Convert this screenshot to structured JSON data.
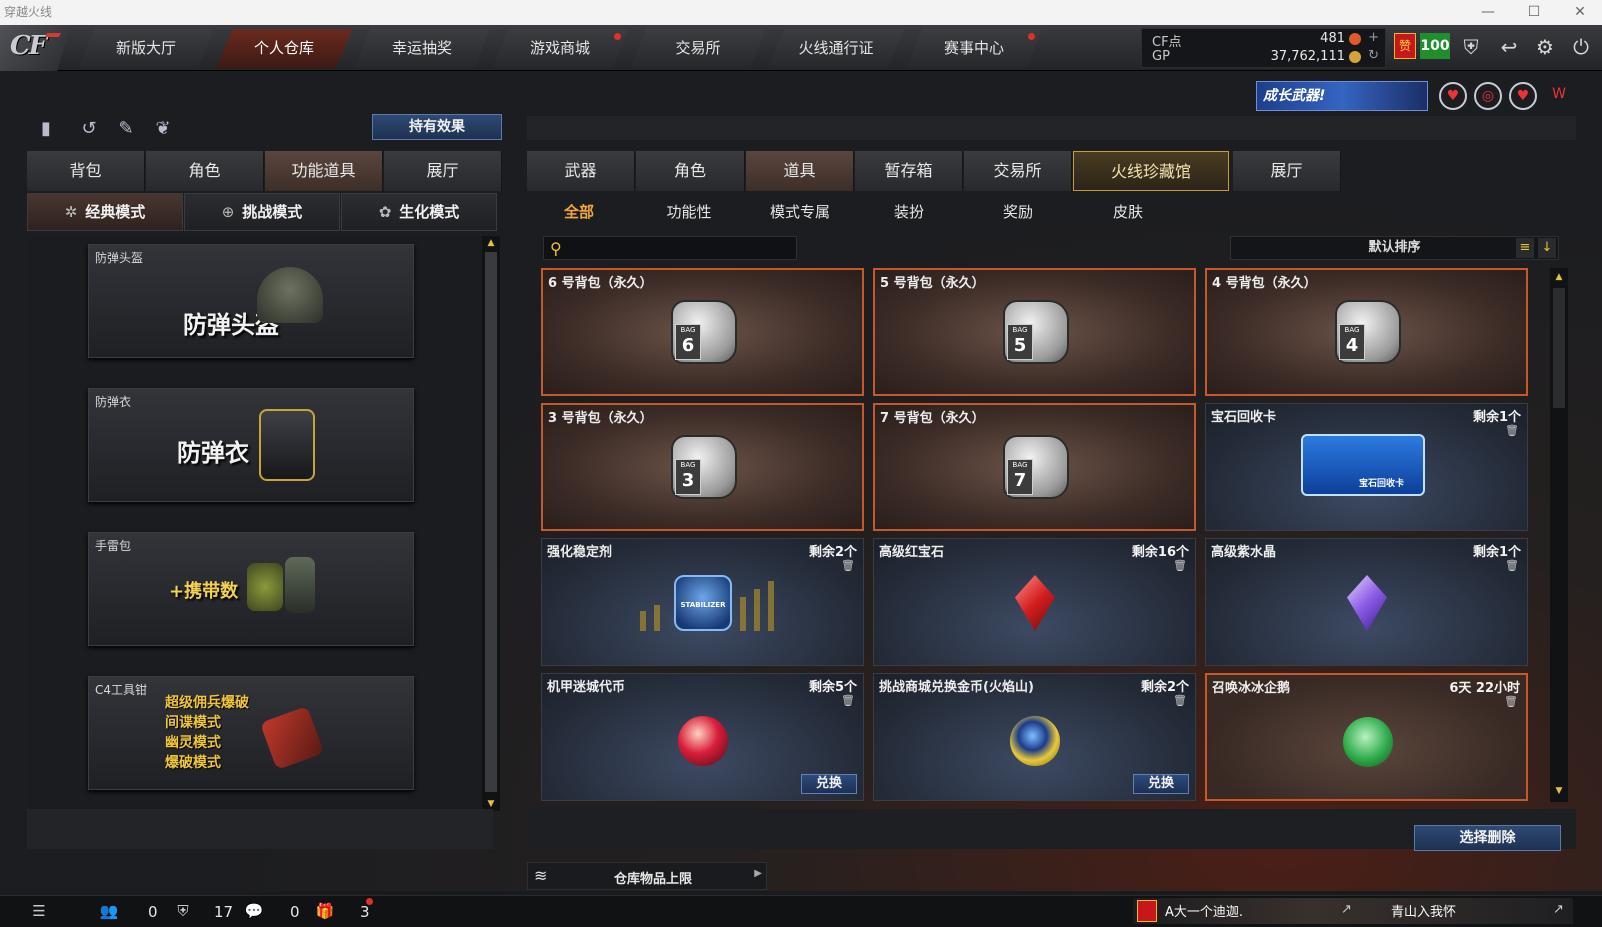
{
  "window": {
    "title": "穿越火线",
    "minimize": "—",
    "maximize": "☐",
    "close": "✕"
  },
  "logo": {
    "text": "CF"
  },
  "nav": {
    "tabs": [
      {
        "label": "新版大厅",
        "dot": false
      },
      {
        "label": "个人仓库",
        "dot": false,
        "active": true
      },
      {
        "label": "幸运抽奖",
        "dot": false
      },
      {
        "label": "游戏商城",
        "dot": true
      },
      {
        "label": "交易所",
        "dot": false
      },
      {
        "label": "火线通行证",
        "dot": false
      },
      {
        "label": "赛事中心",
        "dot": true
      }
    ]
  },
  "currency": {
    "cf_label": "CF点",
    "cf_value": "481",
    "cf_action": "+",
    "gp_label": "GP",
    "gp_value": "37,762,111",
    "gp_action": "↻"
  },
  "badges": {
    "vip": "赞",
    "level": "100"
  },
  "toolbar": {
    "icons": [
      "shield-icon",
      "return-icon",
      "settings-icon",
      "power-icon"
    ],
    "glyphs": [
      "⛨",
      "↩",
      "⚙",
      "⏻"
    ]
  },
  "promo": {
    "text": "成长武器!",
    "icons": [
      "emblem-icon",
      "globe-icon",
      "heart-icon",
      "wings-icon"
    ],
    "glyphs": [
      "♥",
      "◎",
      "♥",
      "W"
    ]
  },
  "left": {
    "icons": [
      "stats-icon",
      "history-icon",
      "character-icon",
      "grenade-icon"
    ],
    "icon_glyphs": [
      "▮",
      "↺",
      "✎",
      "❦"
    ],
    "effect_button": "持有效果",
    "tabs": [
      {
        "label": "背包"
      },
      {
        "label": "角色"
      },
      {
        "label": "功能道具",
        "active": true
      },
      {
        "label": "展厅"
      }
    ],
    "modes": [
      {
        "label": "经典模式",
        "glyph": "✲",
        "active": true
      },
      {
        "label": "挑战模式",
        "glyph": "⊕"
      },
      {
        "label": "生化模式",
        "glyph": "✿"
      }
    ],
    "cards": [
      {
        "title": "防弹头盔",
        "text": "防弹头盔"
      },
      {
        "title": "防弹衣",
        "text": "防弹衣"
      },
      {
        "title": "手雷包",
        "text": "+携带数"
      },
      {
        "title": "C4工具钳",
        "lines": [
          "超级佣兵爆破",
          "间谍模式",
          "幽灵模式",
          "爆破模式"
        ]
      }
    ]
  },
  "right": {
    "tabs": [
      {
        "label": "武器"
      },
      {
        "label": "角色"
      },
      {
        "label": "道具",
        "active": true
      },
      {
        "label": "暂存箱"
      },
      {
        "label": "交易所"
      },
      {
        "label": "火线珍藏馆",
        "highlight": true
      },
      {
        "label": "展厅"
      }
    ],
    "subtabs": [
      {
        "label": "全部",
        "active": true
      },
      {
        "label": "功能性"
      },
      {
        "label": "模式专属"
      },
      {
        "label": "装扮"
      },
      {
        "label": "奖励"
      },
      {
        "label": "皮肤"
      }
    ],
    "search": {
      "placeholder": "",
      "value": ""
    },
    "sort": {
      "label": "默认排序"
    },
    "items": [
      {
        "name": "6 号背包（永久）",
        "kind": "bag",
        "num": "6",
        "remain": ""
      },
      {
        "name": "5 号背包（永久）",
        "kind": "bag",
        "num": "5",
        "remain": ""
      },
      {
        "name": "4 号背包（永久）",
        "kind": "bag",
        "num": "4",
        "remain": ""
      },
      {
        "name": "3 号背包（永久）",
        "kind": "bag",
        "num": "3",
        "remain": ""
      },
      {
        "name": "7 号背包（永久）",
        "kind": "bag",
        "num": "7",
        "remain": ""
      },
      {
        "name": "宝石回收卡",
        "kind": "card",
        "remain": "剩余1个",
        "card_text": "宝石回收卡"
      },
      {
        "name": "强化稳定剂",
        "kind": "stabilizer",
        "remain": "剩余2个",
        "stab_text": "STABILIZER"
      },
      {
        "name": "高级红宝石",
        "kind": "ruby",
        "remain": "剩余16个"
      },
      {
        "name": "高级紫水晶",
        "kind": "amethyst",
        "remain": "剩余1个"
      },
      {
        "name": "机甲迷城代币",
        "kind": "coin-red",
        "remain": "剩余5个",
        "exchange": "兑换"
      },
      {
        "name": "挑战商城兑换金币(火焰山)",
        "kind": "coin-gold",
        "remain": "剩余2个",
        "exchange": "兑换"
      },
      {
        "name": "召唤冰冰企鹅",
        "kind": "penguin",
        "remain": "6天 22小时"
      }
    ],
    "delete_button": "选择删除",
    "limit_label": "仓库物品上限"
  },
  "statusbar": {
    "friends_count": "0",
    "clan_count": "17",
    "chat_count": "0",
    "gift_count": "3",
    "chat_user1": "A大一个迪迦.",
    "chat_user2": "青山入我怀"
  }
}
